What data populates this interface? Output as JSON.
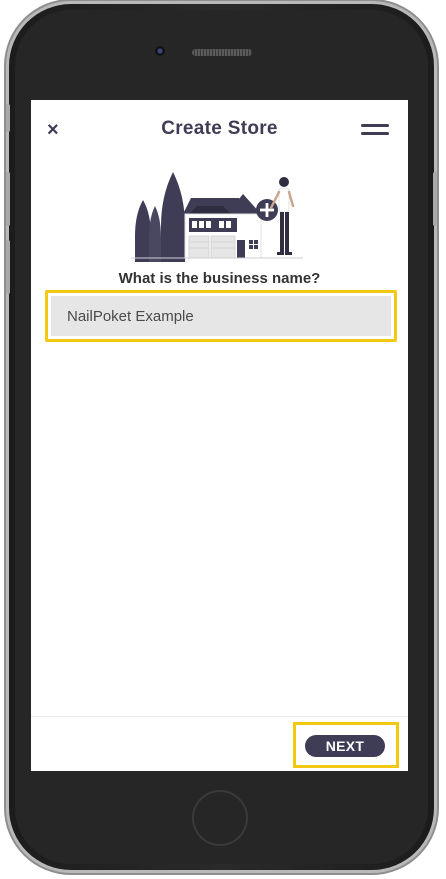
{
  "header": {
    "title": "Create Store",
    "close_icon": "×"
  },
  "form": {
    "question": "What is the business name?",
    "business_name_value": "NailPoket Example"
  },
  "footer": {
    "next_label": "NEXT"
  },
  "colors": {
    "primary": "#3f3d56",
    "highlight": "#f2c811",
    "input_bg": "#e6e6e6"
  }
}
